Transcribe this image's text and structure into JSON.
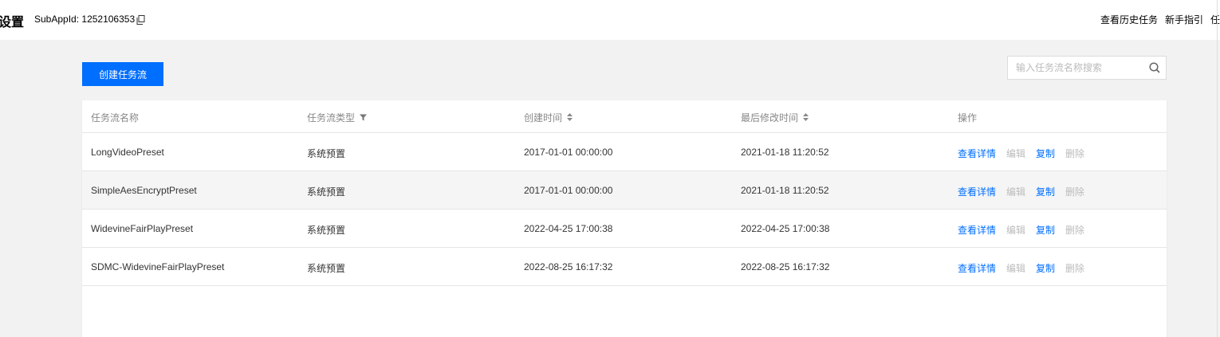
{
  "header": {
    "title": "设置",
    "subapp_label": "SubAppId:",
    "subapp_value": "1252106353",
    "links": [
      "查看历史任务",
      "新手指引",
      "任"
    ]
  },
  "toolbar": {
    "create_label": "创建任务流",
    "search_placeholder": "输入任务流名称搜索"
  },
  "table": {
    "columns": [
      "任务流名称",
      "任务流类型",
      "创建时间",
      "最后修改时间",
      "操作"
    ],
    "rows": [
      {
        "name": "LongVideoPreset",
        "type": "系统预置",
        "created": "2017-01-01 00:00:00",
        "modified": "2021-01-18 11:20:52"
      },
      {
        "name": "SimpleAesEncryptPreset",
        "type": "系统预置",
        "created": "2017-01-01 00:00:00",
        "modified": "2021-01-18 11:20:52"
      },
      {
        "name": "WidevineFairPlayPreset",
        "type": "系统预置",
        "created": "2022-04-25 17:00:38",
        "modified": "2022-04-25 17:00:38"
      },
      {
        "name": "SDMC-WidevineFairPlayPreset",
        "type": "系统预置",
        "created": "2022-08-25 16:17:32",
        "modified": "2022-08-25 16:17:32"
      }
    ],
    "actions": {
      "view": "查看详情",
      "edit": "编辑",
      "copy": "复制",
      "delete": "删除"
    }
  },
  "colors": {
    "accent": "#006eff",
    "disabled": "#bbbbbb",
    "background": "#f2f2f2"
  }
}
